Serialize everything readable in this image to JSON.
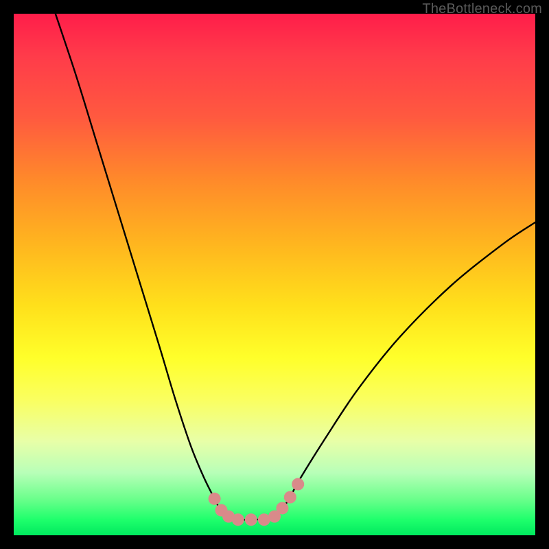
{
  "watermark": "TheBottleneck.com",
  "chart_data": {
    "type": "line",
    "title": "",
    "xlabel": "",
    "ylabel": "",
    "xlim": [
      0,
      100
    ],
    "ylim": [
      0,
      100
    ],
    "series": [
      {
        "name": "bottleneck-curve",
        "x": [
          8,
          12,
          16,
          20,
          24,
          28,
          31,
          34,
          36.5,
          38.5,
          40,
          41.5,
          43,
          46,
          49,
          50.5,
          52.5,
          55,
          60,
          66,
          74,
          84,
          94,
          100
        ],
        "y": [
          100,
          88,
          75,
          62,
          49,
          36,
          26,
          17,
          11,
          7,
          4.2,
          3.2,
          3,
          3,
          3.2,
          4,
          6.5,
          11,
          19,
          28,
          38,
          48,
          56,
          60
        ]
      }
    ],
    "markers": [
      {
        "name": "pink-left-1",
        "x": 38.5,
        "y": 7.0
      },
      {
        "name": "pink-left-2",
        "x": 39.8,
        "y": 4.8
      },
      {
        "name": "pink-left-3",
        "x": 41.2,
        "y": 3.6
      },
      {
        "name": "pink-bottom-1",
        "x": 43.0,
        "y": 3.0
      },
      {
        "name": "pink-bottom-2",
        "x": 45.5,
        "y": 3.0
      },
      {
        "name": "pink-bottom-3",
        "x": 48.0,
        "y": 3.0
      },
      {
        "name": "pink-right-1",
        "x": 50.0,
        "y": 3.6
      },
      {
        "name": "pink-right-2",
        "x": 51.5,
        "y": 5.2
      },
      {
        "name": "pink-right-3",
        "x": 53.0,
        "y": 7.3
      },
      {
        "name": "pink-right-4",
        "x": 54.5,
        "y": 9.8
      }
    ],
    "colors": {
      "curve": "#000000",
      "marker": "#d98a8a"
    }
  }
}
